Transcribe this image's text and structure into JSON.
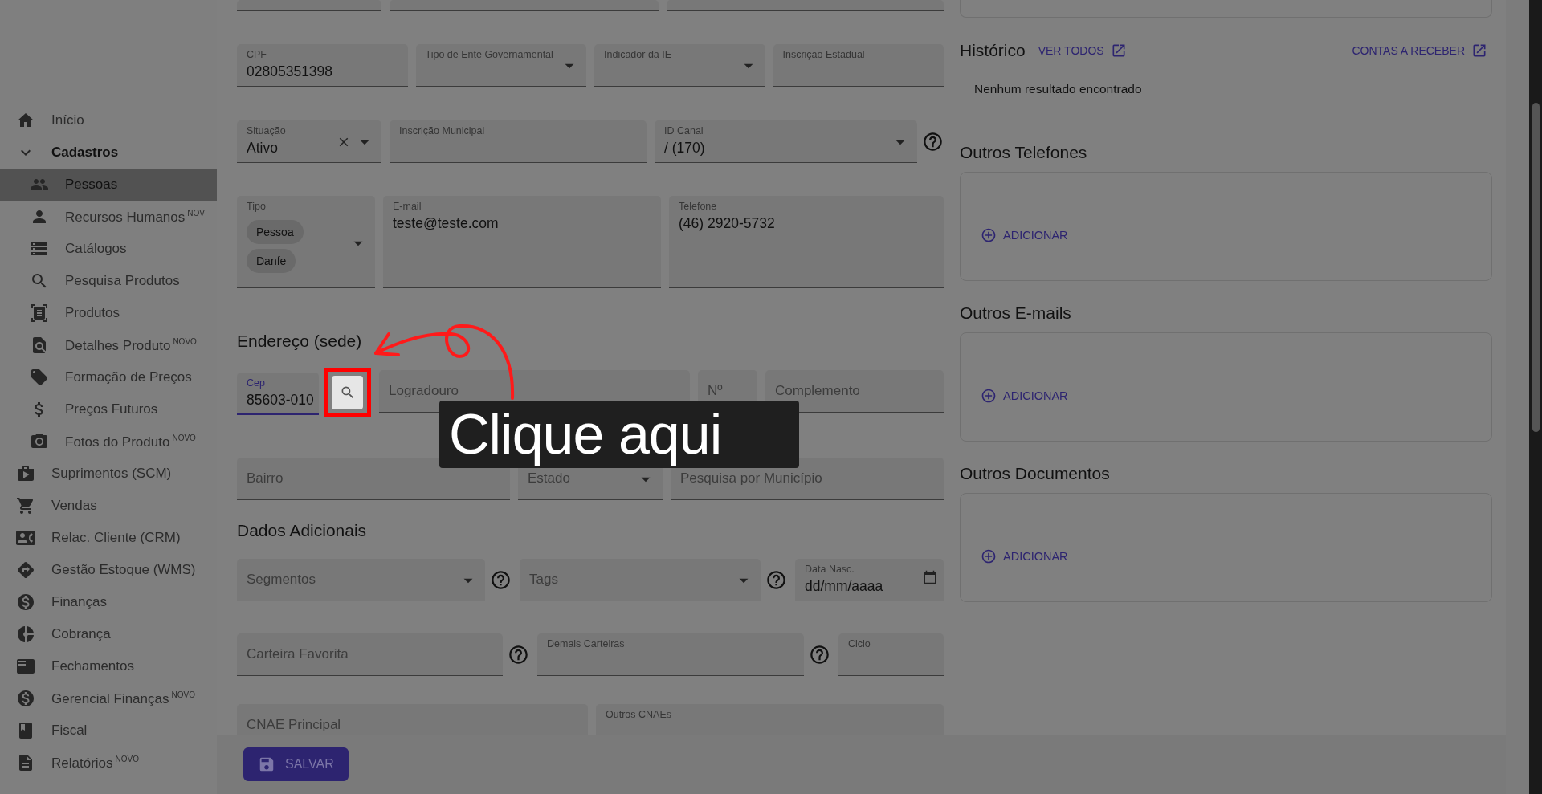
{
  "sidebar": {
    "items": [
      {
        "label": "Início",
        "selected": false
      },
      {
        "label": "Cadastros",
        "selected": false,
        "expanded": true,
        "children": [
          {
            "label": "Pessoas",
            "selected": true
          },
          {
            "label": "Recursos Humanos",
            "badge": "NOV",
            "selected": false
          },
          {
            "label": "Catálogos",
            "selected": false
          },
          {
            "label": "Pesquisa Produtos",
            "selected": false
          },
          {
            "label": "Produtos",
            "selected": false
          },
          {
            "label": "Detalhes Produto",
            "badge": "NOVO",
            "selected": false
          },
          {
            "label": "Formação de Preços",
            "selected": false
          },
          {
            "label": "Preços Futuros",
            "selected": false
          },
          {
            "label": "Fotos do Produto",
            "badge": "NOVO",
            "selected": false
          }
        ]
      },
      {
        "label": "Suprimentos (SCM)",
        "selected": false
      },
      {
        "label": "Vendas",
        "selected": false
      },
      {
        "label": "Relac. Cliente (CRM)",
        "selected": false
      },
      {
        "label": "Gestão Estoque (WMS)",
        "selected": false
      },
      {
        "label": "Finanças",
        "selected": false
      },
      {
        "label": "Cobrança",
        "selected": false
      },
      {
        "label": "Fechamentos",
        "selected": false
      },
      {
        "label": "Gerencial Finanças",
        "badge": "NOVO",
        "selected": false
      },
      {
        "label": "Fiscal",
        "selected": false
      },
      {
        "label": "Relatórios",
        "badge": "NOVO",
        "selected": false
      }
    ]
  },
  "form": {
    "sections": [
      {
        "rows": [
          [
            {
              "kind": "text",
              "focused": false
            },
            {
              "kind": "text",
              "focused": false
            },
            {
              "kind": "text",
              "focused": false
            }
          ],
          [
            {
              "kind": "text",
              "label": "CPF",
              "value": "02805351398",
              "floated": true,
              "focused": false
            },
            {
              "kind": "select",
              "label": "Tipo de Ente Governamental",
              "floated": true,
              "focused": false
            },
            {
              "kind": "select",
              "label": "Indicador da IE",
              "floated": true,
              "focused": false
            },
            {
              "kind": "text",
              "label": "Inscrição Estadual",
              "floated": true,
              "focused": false
            }
          ],
          [
            {
              "kind": "select",
              "label": "Situação",
              "value": "Ativo",
              "floated": true,
              "focused": false,
              "clearable": true
            },
            {
              "kind": "text",
              "label": "Inscrição Municipal",
              "floated": true,
              "focused": false
            },
            {
              "kind": "select",
              "label": "ID Canal",
              "value": "/ (170)",
              "floated": true,
              "focused": false,
              "help": true
            }
          ],
          [
            {
              "kind": "chips",
              "label": "Tipo",
              "chips": [
                "Pessoa",
                "Danfe"
              ],
              "floated": true,
              "focused": false
            },
            {
              "kind": "text",
              "label": "E-mail",
              "value": "teste@teste.com",
              "floated": true,
              "focused": false
            },
            {
              "kind": "text",
              "label": "Telefone",
              "value": "(46) 2920-5732",
              "floated": true,
              "focused": false
            }
          ]
        ]
      },
      {
        "heading": "Endereço (sede)",
        "rows": [
          [
            {
              "kind": "search",
              "label": "Cep",
              "value": "85603-010",
              "floated": true,
              "focused": true
            },
            {
              "kind": "text",
              "label": "Logradouro",
              "floated": false,
              "focused": false
            },
            {
              "kind": "text",
              "label": "Nº",
              "floated": false,
              "focused": false
            },
            {
              "kind": "text",
              "label": "Complemento",
              "floated": false,
              "focused": false
            }
          ],
          [
            {
              "kind": "text",
              "label": "Bairro",
              "floated": false,
              "focused": false
            },
            {
              "kind": "select",
              "label": "Estado",
              "floated": false,
              "focused": false
            },
            {
              "kind": "text",
              "label": "Pesquisa por Município",
              "floated": false,
              "focused": false
            }
          ]
        ]
      },
      {
        "heading": "Dados Adicionais",
        "rows": [
          [
            {
              "kind": "select",
              "label": "Segmentos",
              "floated": false,
              "focused": false,
              "help": true
            },
            {
              "kind": "select",
              "label": "Tags",
              "floated": false,
              "focused": false,
              "help": true
            },
            {
              "kind": "date",
              "label": "Data Nasc.",
              "value": "dd/mm/aaaa",
              "floated": true,
              "focused": false
            }
          ],
          [
            {
              "kind": "text",
              "label": "Carteira Favorita",
              "floated": false,
              "focused": false,
              "help": true
            },
            {
              "kind": "text",
              "label": "Demais Carteiras",
              "floated": true,
              "focused": false,
              "help": true
            },
            {
              "kind": "text",
              "label": "Ciclo",
              "floated": true,
              "focused": false
            }
          ],
          [
            {
              "kind": "text",
              "label": "CNAE Principal",
              "floated": false,
              "focused": false
            },
            {
              "kind": "text",
              "label": "Outros CNAEs",
              "floated": true,
              "focused": false
            }
          ]
        ]
      }
    ]
  },
  "history": {
    "title": "Histórico",
    "links": [
      "VER TODOS",
      "CONTAS A RECEBER"
    ],
    "empty_text": "Nenhum resultado encontrado"
  },
  "lists": [
    {
      "title": "Outros Telefones",
      "action": "ADICIONAR"
    },
    {
      "title": "Outros E-mails",
      "action": "ADICIONAR"
    },
    {
      "title": "Outros Documentos",
      "action": "ADICIONAR"
    }
  ],
  "save_button": "SALVAR",
  "callout": {
    "text": "Clique aqui"
  }
}
